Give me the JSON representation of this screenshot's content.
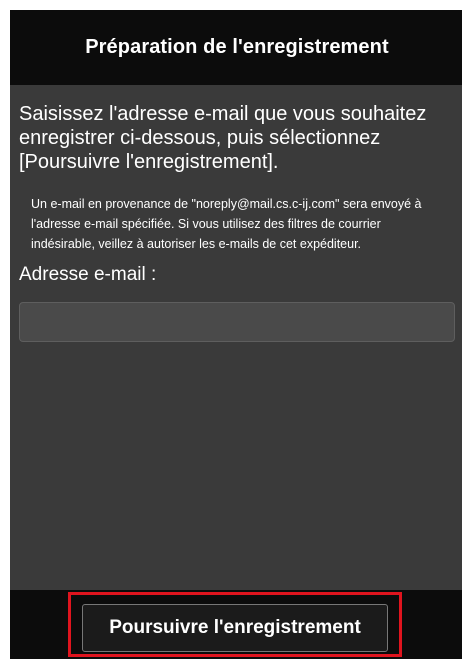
{
  "header": {
    "title": "Préparation de l'enregistrement"
  },
  "main": {
    "instruction": "Saisissez l'adresse e-mail que vous souhaitez enregistrer ci-dessous, puis sélectionnez [Poursuivre l'enregistrement].",
    "note": "Un e-mail en provenance de \"noreply@mail.cs.c-ij.com\" sera envoyé à l'adresse e-mail spécifiée. Si vous utilisez des filtres de courrier indésirable, veillez à autoriser les e-mails de cet expéditeur.",
    "email_label": "Adresse e-mail :",
    "email_value": ""
  },
  "footer": {
    "continue_label": "Poursuivre l'enregistrement"
  },
  "colors": {
    "header_background": "#0c0c0c",
    "content_background": "#3a3a3a",
    "highlight": "#e0141e"
  }
}
